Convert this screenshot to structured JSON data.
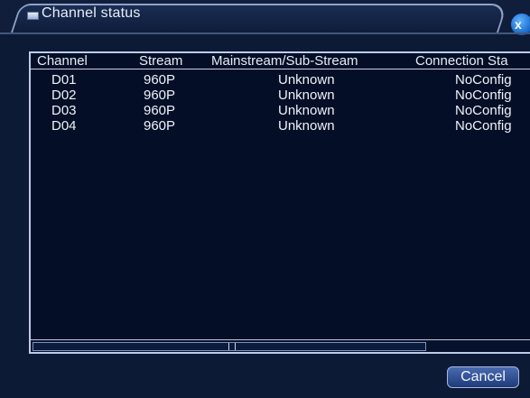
{
  "window": {
    "title": "Channel status",
    "close_label": "x"
  },
  "table": {
    "columns": [
      "Channel",
      "Stream",
      "Mainstream/Sub-Stream",
      "Connection Sta"
    ],
    "rows": [
      [
        "D01",
        "960P",
        "Unknown",
        "NoConfig"
      ],
      [
        "D02",
        "960P",
        "Unknown",
        "NoConfig"
      ],
      [
        "D03",
        "960P",
        "Unknown",
        "NoConfig"
      ],
      [
        "D04",
        "960P",
        "Unknown",
        "NoConfig"
      ]
    ]
  },
  "footer": {
    "cancel_label": "Cancel"
  }
}
